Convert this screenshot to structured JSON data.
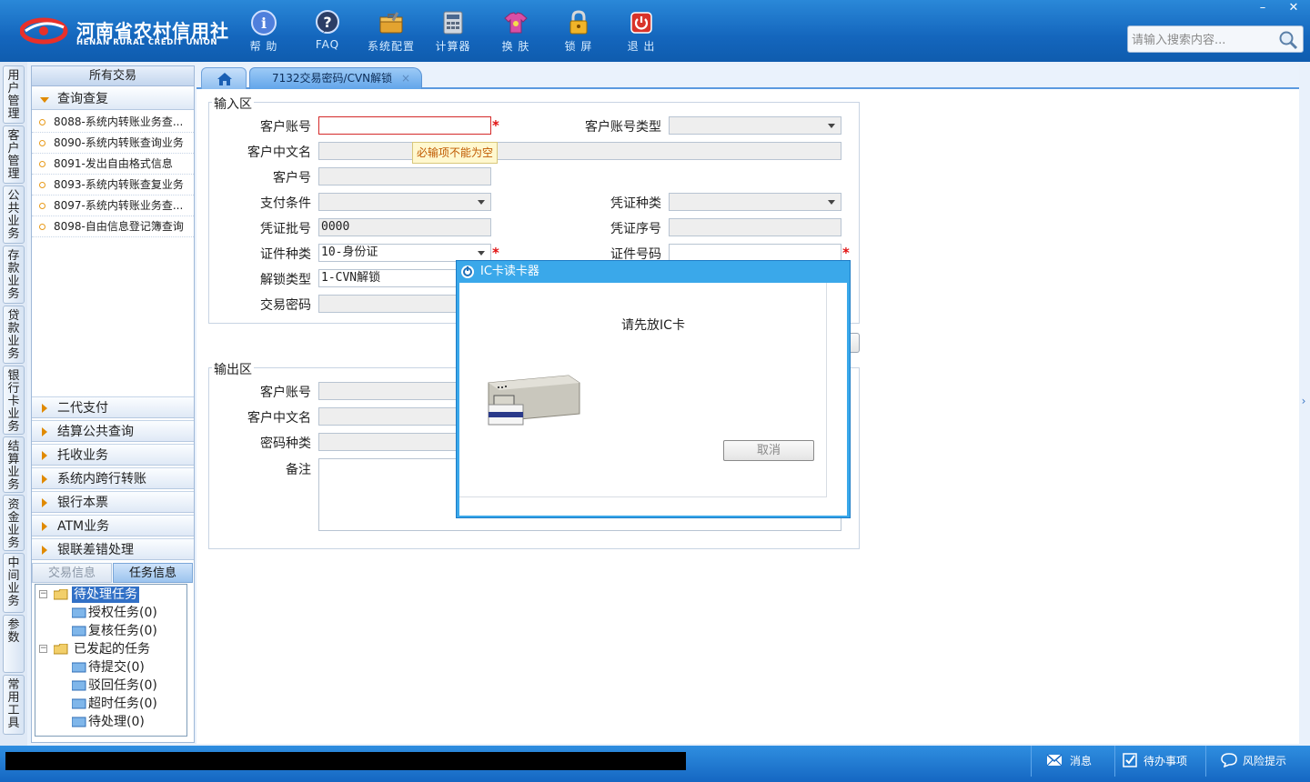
{
  "app": {
    "logo_cn": "河南省农村信用社",
    "logo_en": "HENAN RURAL CREDIT UNION"
  },
  "toolbar": [
    {
      "label": "帮 助",
      "icon": "help-icon"
    },
    {
      "label": "FAQ",
      "icon": "faq-icon"
    },
    {
      "label": "系统配置",
      "icon": "config-toolbox-icon"
    },
    {
      "label": "计算器",
      "icon": "calculator-icon"
    },
    {
      "label": "换 肤",
      "icon": "skin-shirt-icon"
    },
    {
      "label": "锁 屏",
      "icon": "lock-icon"
    },
    {
      "label": "退 出",
      "icon": "power-icon"
    }
  ],
  "search": {
    "placeholder": "请输入搜索内容..."
  },
  "window_controls": {
    "minimize": "–",
    "close": "✕"
  },
  "vertical_tabs": [
    "用户管理",
    "客户管理",
    "公共业务",
    "存款业务",
    "贷款业务",
    "银行卡业务",
    "结算业务",
    "资金业务",
    "中间业务",
    "参数",
    "常用工具"
  ],
  "nav": {
    "header": "所有交易",
    "open_group": "查询查复",
    "links": [
      "8088-系统内转账业务查...",
      "8090-系统内转账查询业务",
      "8091-发出自由格式信息",
      "8093-系统内转账查复业务",
      "8097-系统内转账业务查...",
      "8098-自由信息登记簿查询"
    ],
    "groups": [
      "二代支付",
      "结算公共查询",
      "托收业务",
      "系统内跨行转账",
      "银行本票",
      "ATM业务",
      "银联差错处理"
    ]
  },
  "info_tabs": {
    "left": "交易信息",
    "right": "任务信息",
    "active": "任务信息"
  },
  "task_tree": {
    "pending": "待处理任务",
    "pending_children": [
      "授权任务(0)",
      "复核任务(0)"
    ],
    "initiated": "已发起的任务",
    "initiated_children": [
      "待提交(0)",
      "驳回任务(0)",
      "超时任务(0)",
      "待处理(0)"
    ]
  },
  "tabs": {
    "current": "7132交易密码/CVN解锁",
    "close": "×"
  },
  "input_zone": {
    "title": "输入区",
    "labels": {
      "account": "客户账号",
      "account_type": "客户账号类型",
      "cn_name": "客户中文名",
      "customer_no": "客户号",
      "pay_cond": "支付条件",
      "voucher_kind": "凭证种类",
      "voucher_batch": "凭证批号",
      "voucher_seq": "凭证序号",
      "id_type": "证件种类",
      "id_no": "证件号码",
      "unlock_type": "解锁类型",
      "trade_pwd": "交易密码"
    },
    "values": {
      "voucher_batch": "0000",
      "id_type": "10-身份证",
      "unlock_type": "1-CVN解锁"
    },
    "required_mark": "*",
    "tooltip": "必输项不能为空"
  },
  "output_zone": {
    "title": "输出区",
    "labels": {
      "account": "客户账号",
      "cn_name": "客户中文名",
      "pwd_type": "密码种类",
      "remark": "备注"
    }
  },
  "dialog": {
    "title": "IC卡读卡器",
    "message": "请先放IC卡",
    "cancel": "取消"
  },
  "statusbar": {
    "messages": "消息",
    "todo": "待办事项",
    "risk": "风险提示"
  },
  "colors": {
    "header_blue": "#1466bd",
    "dialog_border": "#3aa8ea",
    "required_red": "#e01010",
    "tooltip_text": "#c05a00"
  }
}
